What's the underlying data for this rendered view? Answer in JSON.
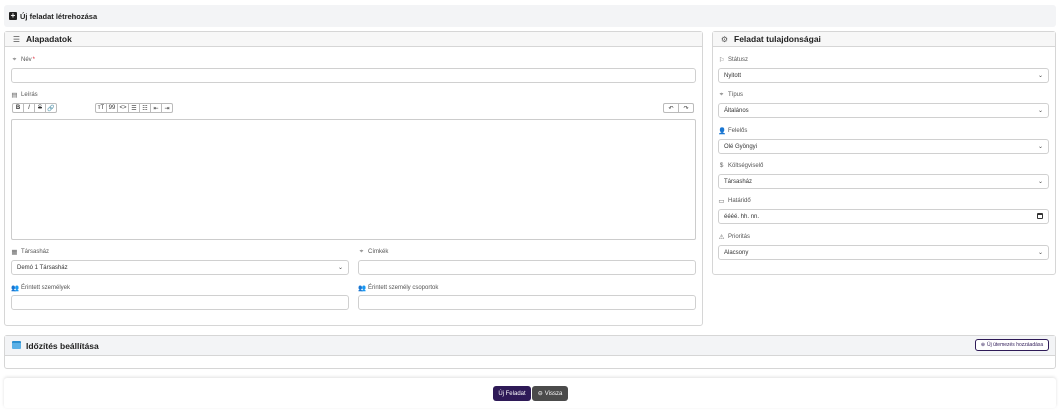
{
  "header": {
    "title": "Új feladat létrehozása"
  },
  "basics": {
    "title": "Alapadatok",
    "name_label": "Név",
    "name_required": "*",
    "description_label": "Leírás",
    "toolbar_left": [
      "B",
      "I",
      "S",
      "🔗"
    ],
    "toolbar_mid": [
      "тT",
      "99",
      "<>",
      "☰",
      "☷",
      "⇤",
      "⇥"
    ],
    "toolbar_right": [
      "↶",
      "↷"
    ],
    "condo_label": "Társasház",
    "condo_value": "Demó 1 Társasház",
    "tags_label": "Címkék",
    "persons_label": "Érintett személyek",
    "groups_label": "Érintett személy csoportok"
  },
  "properties": {
    "title": "Feladat tulajdonságai",
    "status_label": "Státusz",
    "status_value": "Nyitott",
    "type_label": "Típus",
    "type_value": "Általános",
    "owner_label": "Felelős",
    "owner_value": "Olé Gyöngyi",
    "cost_label": "Költségviselő",
    "cost_value": "Társasház",
    "deadline_label": "Határidő",
    "deadline_placeholder": "éééé. hh. nn.",
    "priority_label": "Prioritás",
    "priority_value": "Alacsony"
  },
  "scheduling": {
    "title": "Időzítés beállítása",
    "add_button": "Új ütemezés hozzáadása"
  },
  "footer": {
    "new_task": "Új Feladat",
    "back": "Vissza"
  }
}
